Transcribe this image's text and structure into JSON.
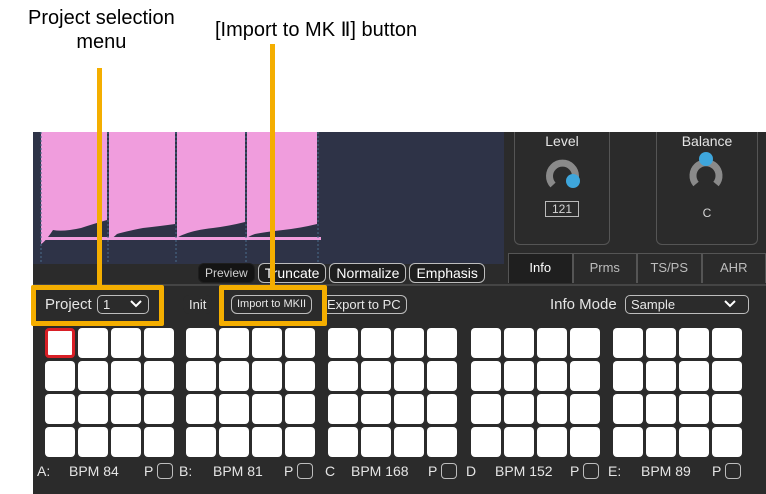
{
  "callouts": {
    "project_menu_line1": "Project selection",
    "project_menu_line2": "menu",
    "import_button": "[Import to MK Ⅱ] button",
    "color": "#f4ae00"
  },
  "waveform": {
    "fill_color": "#f09ddd",
    "background": "#2e3347",
    "buttons": [
      "Preview",
      "Truncate",
      "Normalize",
      "Emphasis"
    ]
  },
  "knobs": {
    "level": {
      "label": "Level",
      "value": "121",
      "accent": "#3ea6dc"
    },
    "balance": {
      "label": "Balance",
      "value": "C",
      "accent": "#3ea6dc"
    }
  },
  "tabs": [
    "Info",
    "Prms",
    "TS/PS",
    "AHR"
  ],
  "toolbar": {
    "project_label": "Project",
    "project_value": "1",
    "init_label": "Init",
    "import_label": "Import to MKII",
    "export_label": "Export to PC",
    "info_mode_label": "Info Mode",
    "info_mode_value": "Sample"
  },
  "banks": [
    {
      "letter": "A:",
      "bpm": "BPM 84",
      "p": "P"
    },
    {
      "letter": "B:",
      "bpm": "BPM 81",
      "p": "P"
    },
    {
      "letter": "C",
      "bpm": "BPM 168",
      "p": "P"
    },
    {
      "letter": "D",
      "bpm": "BPM 152",
      "p": "P"
    },
    {
      "letter": "E:",
      "bpm": "BPM 89",
      "p": "P"
    }
  ],
  "selection_color": "#d81f26"
}
